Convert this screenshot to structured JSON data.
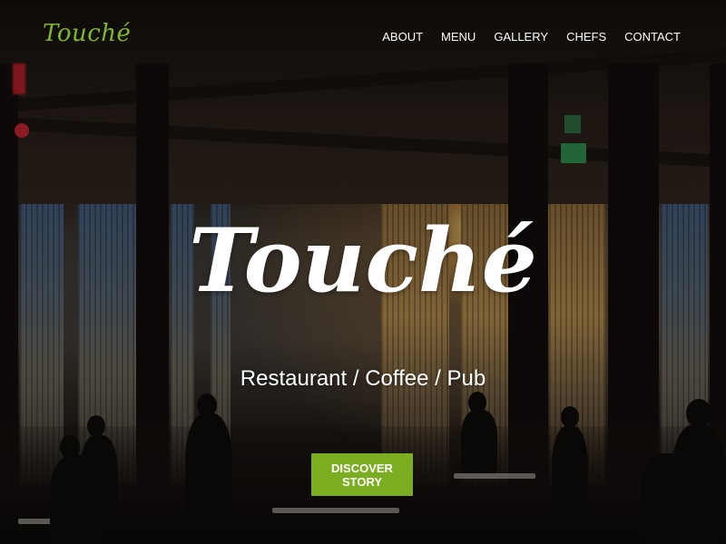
{
  "brand": {
    "logo_text": "Touché",
    "accent_color": "#7aad1f"
  },
  "nav": {
    "items": [
      {
        "label": "ABOUT"
      },
      {
        "label": "MENU"
      },
      {
        "label": "GALLERY"
      },
      {
        "label": "CHEFS"
      },
      {
        "label": "CONTACT"
      }
    ]
  },
  "hero": {
    "title": "Touché",
    "subtitle": "Restaurant / Coffee / Pub",
    "cta_label": "DISCOVER STORY",
    "background": "restaurant-interior-photo"
  }
}
